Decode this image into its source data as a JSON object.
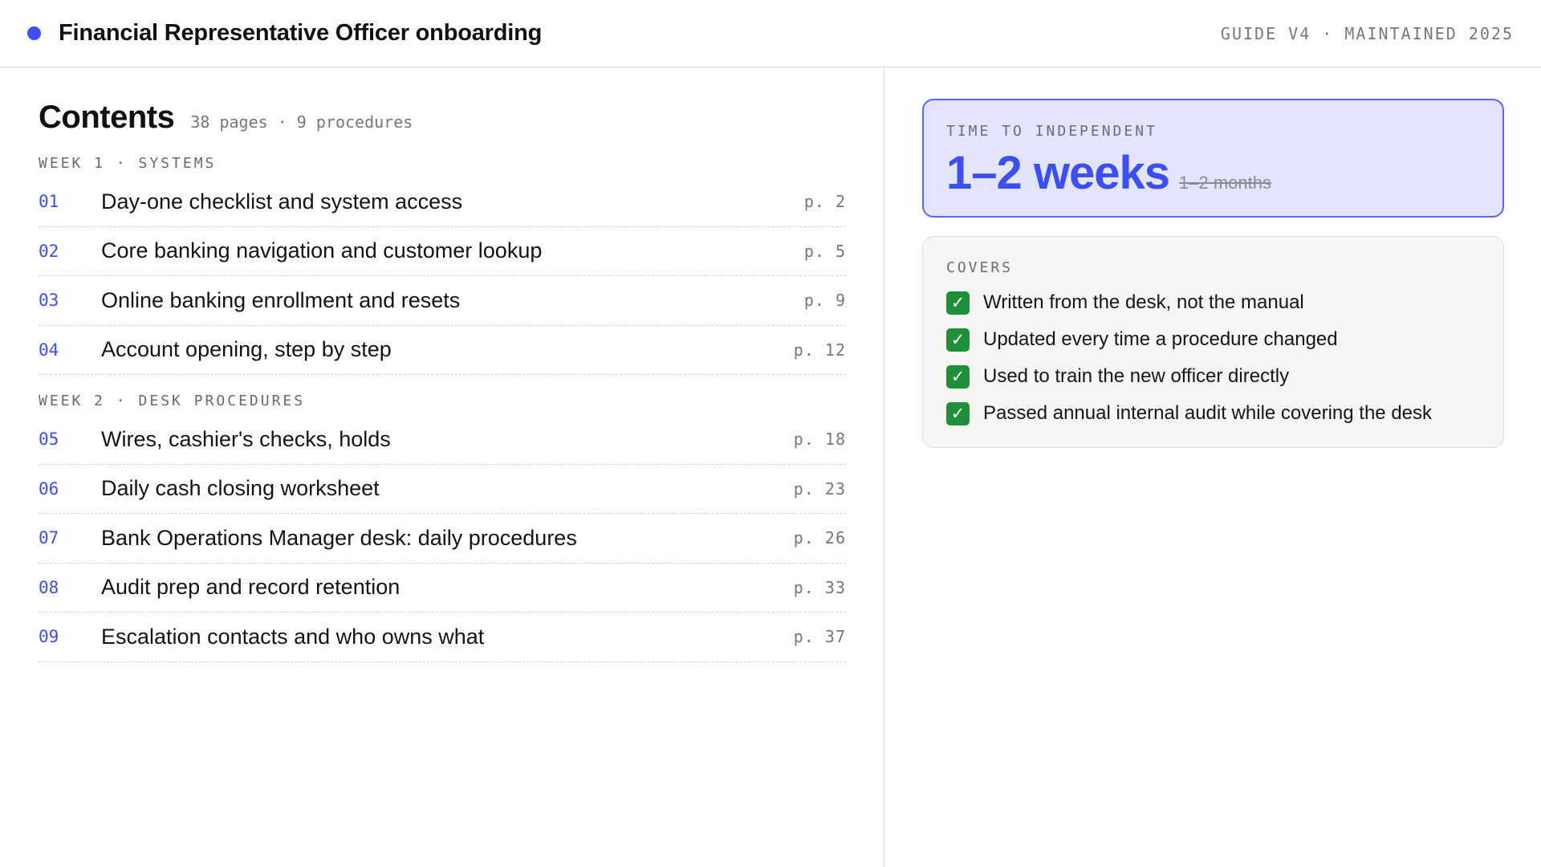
{
  "header": {
    "title": "Financial Representative Officer onboarding",
    "meta": "GUIDE V4 · MAINTAINED 2025",
    "accent_color": "#3d4ef5"
  },
  "contents": {
    "title": "Contents",
    "meta": "38 pages · 9 procedures",
    "sections": [
      {
        "label": "WEEK 1 · SYSTEMS",
        "items": [
          {
            "num": "01",
            "title": "Day-one checklist and system access",
            "page": "p. 2"
          },
          {
            "num": "02",
            "title": "Core banking navigation and customer lookup",
            "page": "p. 5"
          },
          {
            "num": "03",
            "title": "Online banking enrollment and resets",
            "page": "p. 9"
          },
          {
            "num": "04",
            "title": "Account opening, step by step",
            "page": "p. 12"
          }
        ]
      },
      {
        "label": "WEEK 2 · DESK PROCEDURES",
        "items": [
          {
            "num": "05",
            "title": "Wires, cashier's checks, holds",
            "page": "p. 18"
          },
          {
            "num": "06",
            "title": "Daily cash closing worksheet",
            "page": "p. 23"
          },
          {
            "num": "07",
            "title": "Bank Operations Manager desk: daily procedures",
            "page": "p. 26"
          },
          {
            "num": "08",
            "title": "Audit prep and record retention",
            "page": "p. 33"
          },
          {
            "num": "09",
            "title": "Escalation contacts and who owns what",
            "page": "p. 37"
          }
        ]
      }
    ]
  },
  "time_card": {
    "label": "TIME TO INDEPENDENT",
    "new_value": "1–2 weeks",
    "old_value": "1–2 months"
  },
  "covers": {
    "label": "COVERS",
    "icon": "checkmark-icon",
    "check_color": "#1f8f3a",
    "items": [
      "Written from the desk, not the manual",
      "Updated every time a procedure changed",
      "Used to train the new officer directly",
      "Passed annual internal audit while covering the desk"
    ]
  }
}
